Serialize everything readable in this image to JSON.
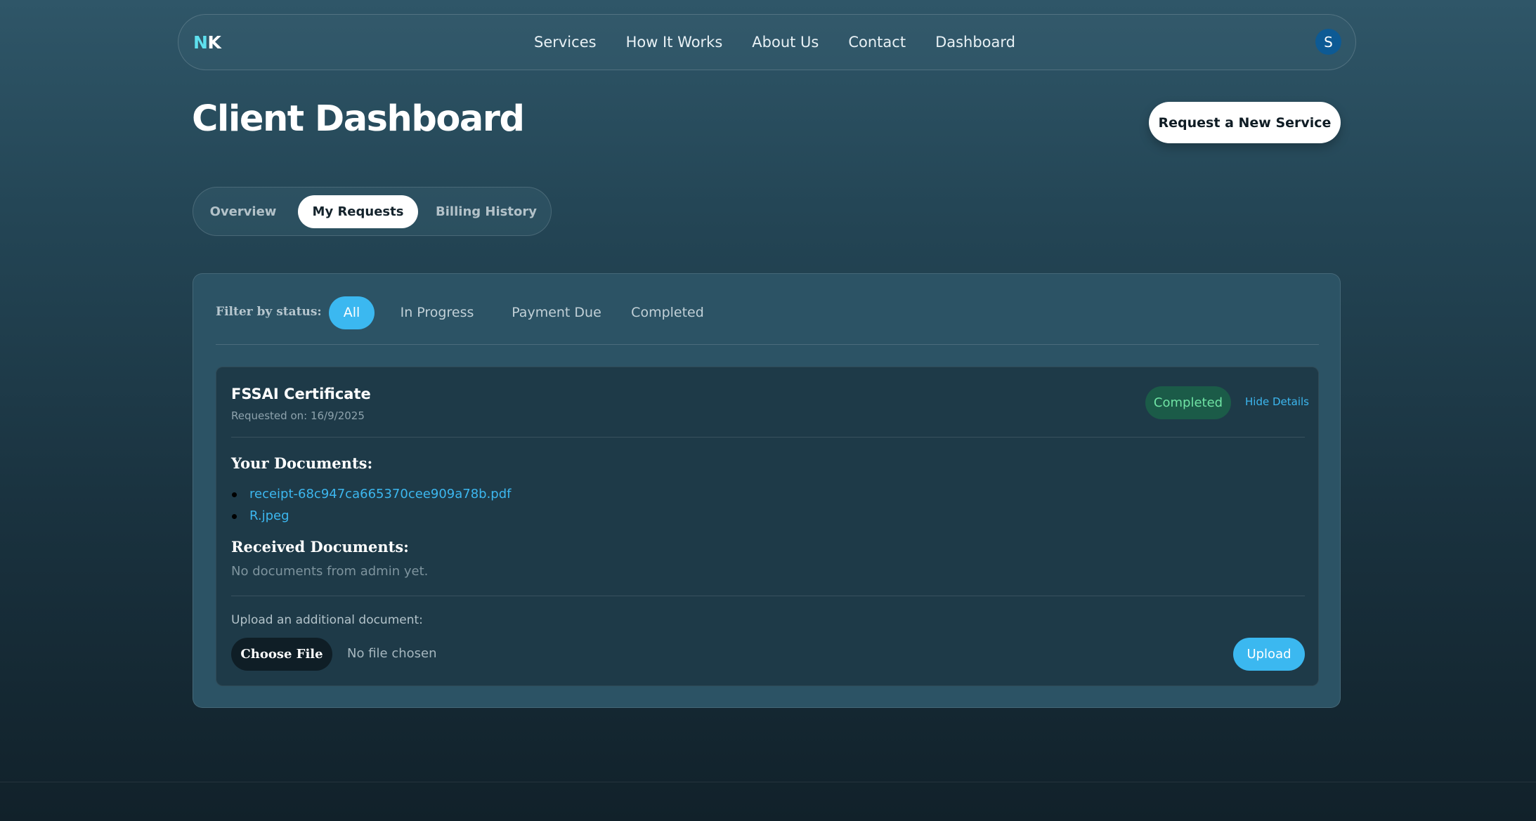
{
  "nav": {
    "logo_part1": "N",
    "logo_part2": "K",
    "links": [
      "Services",
      "How It Works",
      "About Us",
      "Contact",
      "Dashboard"
    ],
    "avatar_initial": "S"
  },
  "header": {
    "title": "Client Dashboard",
    "new_service_label": "Request a New Service"
  },
  "tabs": [
    "Overview",
    "My Requests",
    "Billing History"
  ],
  "active_tab": "My Requests",
  "filter": {
    "label": "Filter by status:",
    "options": [
      "All",
      "In Progress",
      "Payment Due",
      "Completed"
    ],
    "active": "All"
  },
  "request": {
    "title": "FSSAI Certificate",
    "requested_on": "Requested on: 16/9/2025",
    "status": "Completed",
    "hide_details_label": "Hide Details",
    "your_documents_heading": "Your Documents:",
    "your_documents": [
      "receipt-68c947ca665370cee909a78b.pdf",
      "R.jpeg"
    ],
    "received_documents_heading": "Received Documents:",
    "received_documents_empty": "No documents from admin yet.",
    "upload_label": "Upload an additional document:",
    "choose_file_label": "Choose File",
    "no_file_text": "No file chosen",
    "upload_button_label": "Upload"
  },
  "colors": {
    "accent": "#3bb8f0",
    "logo_accent": "#5ee0ee",
    "status_completed_bg": "#1b5b48",
    "status_completed_text": "#6fe3a4"
  }
}
